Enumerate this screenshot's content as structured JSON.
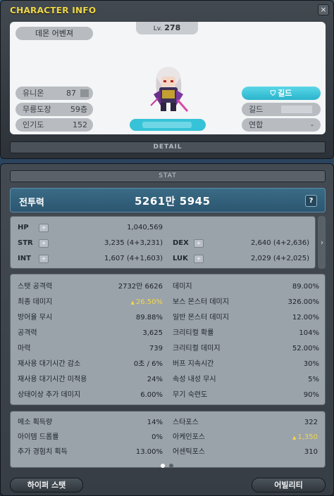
{
  "window": {
    "title": "CHARACTER INFO",
    "close_label": "×"
  },
  "profile": {
    "job": "데몬 어벤져",
    "level_prefix": "Lv.",
    "level": "278",
    "left_info": [
      {
        "label": "유니온",
        "value": "87"
      },
      {
        "label": "무릉도장",
        "value": "59층"
      },
      {
        "label": "인기도",
        "value": "152"
      }
    ],
    "guild_button": "길드",
    "right_info": [
      {
        "label": "길드",
        "value": ""
      },
      {
        "label": "연합",
        "value": "-"
      }
    ],
    "detail_tab": "DETAIL"
  },
  "stat": {
    "tab_label": "STAT",
    "power_label": "전투력",
    "power_value": "5261만 5945",
    "help_label": "?",
    "plus_label": "+",
    "scroll_arrow": "›",
    "base_stats": [
      {
        "label": "HP",
        "value": "1,040,569"
      },
      {
        "label": "STR",
        "value": "3,235 (4+3,231)"
      },
      {
        "label": "DEX",
        "value": "2,640 (4+2,636)"
      },
      {
        "label": "INT",
        "value": "1,607 (4+1,603)"
      },
      {
        "label": "LUK",
        "value": "2,029 (4+2,025)"
      }
    ],
    "detail_left": [
      {
        "label": "스탯 공격력",
        "value": "2732만 6626"
      },
      {
        "label": "최종 데미지",
        "value": "26.50%",
        "arrow": "▲"
      },
      {
        "label": "방어율 무시",
        "value": "89.88%"
      },
      {
        "label": "공격력",
        "value": "3,625"
      },
      {
        "label": "마력",
        "value": "739"
      },
      {
        "label": "재사용 대기시간 감소",
        "value": "0초 / 6%"
      },
      {
        "label": "재사용 대기시간 미적용",
        "value": "24%"
      },
      {
        "label": "상태이상 추가 데미지",
        "value": "6.00%"
      }
    ],
    "detail_right": [
      {
        "label": "데미지",
        "value": "89.00%"
      },
      {
        "label": "보스 몬스터 데미지",
        "value": "326.00%"
      },
      {
        "label": "일반 몬스터 데미지",
        "value": "12.00%"
      },
      {
        "label": "크리티컬 확률",
        "value": "104%"
      },
      {
        "label": "크리티컬 데미지",
        "value": "52.00%"
      },
      {
        "label": "버프 지속시간",
        "value": "30%"
      },
      {
        "label": "속성 내성 무시",
        "value": "5%"
      },
      {
        "label": "무기 숙련도",
        "value": "90%"
      }
    ],
    "misc_left": [
      {
        "label": "메소 획득량",
        "value": "14%"
      },
      {
        "label": "아이템 드롭률",
        "value": "0%"
      },
      {
        "label": "추가 경험치 획득",
        "value": "13.00%"
      }
    ],
    "misc_right": [
      {
        "label": "스타포스",
        "value": "322"
      },
      {
        "label": "아케인포스",
        "value": "1,350",
        "arrow": "▲"
      },
      {
        "label": "어센틱포스",
        "value": "310"
      }
    ]
  },
  "buttons": {
    "hyper_stat": "하이퍼 스탯",
    "ability": "어빌리티"
  },
  "colors": {
    "title": "#f0d84a",
    "accent": "#2ab4cc",
    "power_bg": "#2c5670",
    "highlight": "#f0d84a"
  }
}
